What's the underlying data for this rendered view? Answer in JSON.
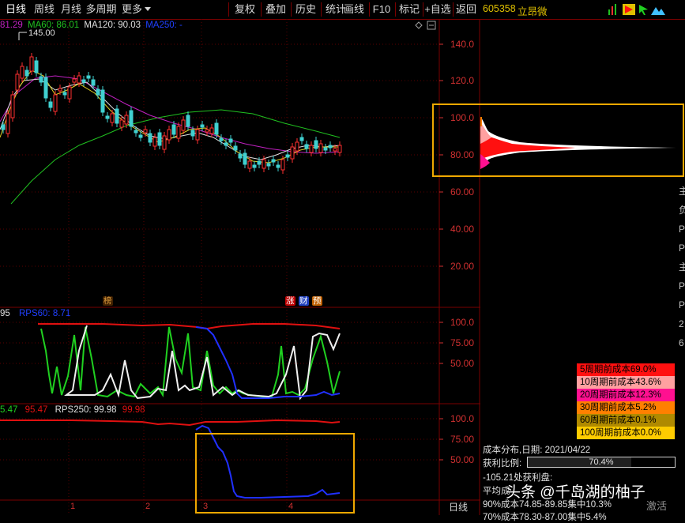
{
  "toolbar": {
    "left_items": [
      "日线",
      "周线",
      "月线",
      "多周期",
      "更多"
    ],
    "right_items": [
      "复权",
      "叠加",
      "历史",
      "统计",
      "画线",
      "F10",
      "标记",
      "+自选",
      "返回"
    ]
  },
  "stock": {
    "code": "605358",
    "name": "立昂微"
  },
  "main_legend": {
    "ma_prefix": "81.29",
    "ma60": "MA60: 86.01",
    "ma120": "MA120: 90.03",
    "ma250": "MA250: -",
    "high_label": "145.00"
  },
  "main_axis": [
    "140.0",
    "120.0",
    "100.0",
    "80.00",
    "60.00",
    "40.00",
    "20.00"
  ],
  "markers": {
    "bang": "榜",
    "zhang": "涨",
    "cai": "财",
    "yu": "预"
  },
  "rps60": {
    "prefix": "95",
    "label": "RPS60: 8.71"
  },
  "rps60_axis": [
    "100.0",
    "75.00",
    "50.00"
  ],
  "rps250": {
    "v1": "5.47",
    "v2": "95.47",
    "label": "RPS250: 99.98",
    "v3": "99.98"
  },
  "rps250_axis": [
    "100.0",
    "75.00",
    "50.00"
  ],
  "time_axis": [
    "1",
    "2",
    "3",
    "4"
  ],
  "period_label": "日线",
  "colors": {
    "ma60": "#20c020",
    "ma120": "#c020c0",
    "ma250": "#2040ff",
    "up": "#ff3030",
    "down": "#40d0d0",
    "axis": "#d03030",
    "highlight": "#f0a800"
  },
  "cost_rows": [
    {
      "label": "5周期前成本69.0%",
      "color": "#ff1010"
    },
    {
      "label": "10周期前成本43.6%",
      "color": "#ffa0a0"
    },
    {
      "label": "20周期前成本12.3%",
      "color": "#ff1090"
    },
    {
      "label": "30周期前成本5.2%",
      "color": "#ff8000"
    },
    {
      "label": "60周期前成本0.1%",
      "color": "#b08a00"
    },
    {
      "label": "100周期前成本0.0%",
      "color": "#ffcc00"
    }
  ],
  "cost_info": {
    "date_line": "成本分布,日期:  2021/04/22",
    "profit_label": "获利比例:",
    "profit_value": "70.4%",
    "profit_ratio": 0.704,
    "profit_line": "-105.21处获利盘:",
    "avg_line": "平均成",
    "c90_line": "90%成本74.85-89.85集中10.3%",
    "c70_line": "70%成本78.30-87.00集中5.4%"
  },
  "watermark": "头条 @千岛湖的柚子",
  "activate": "激活"
}
